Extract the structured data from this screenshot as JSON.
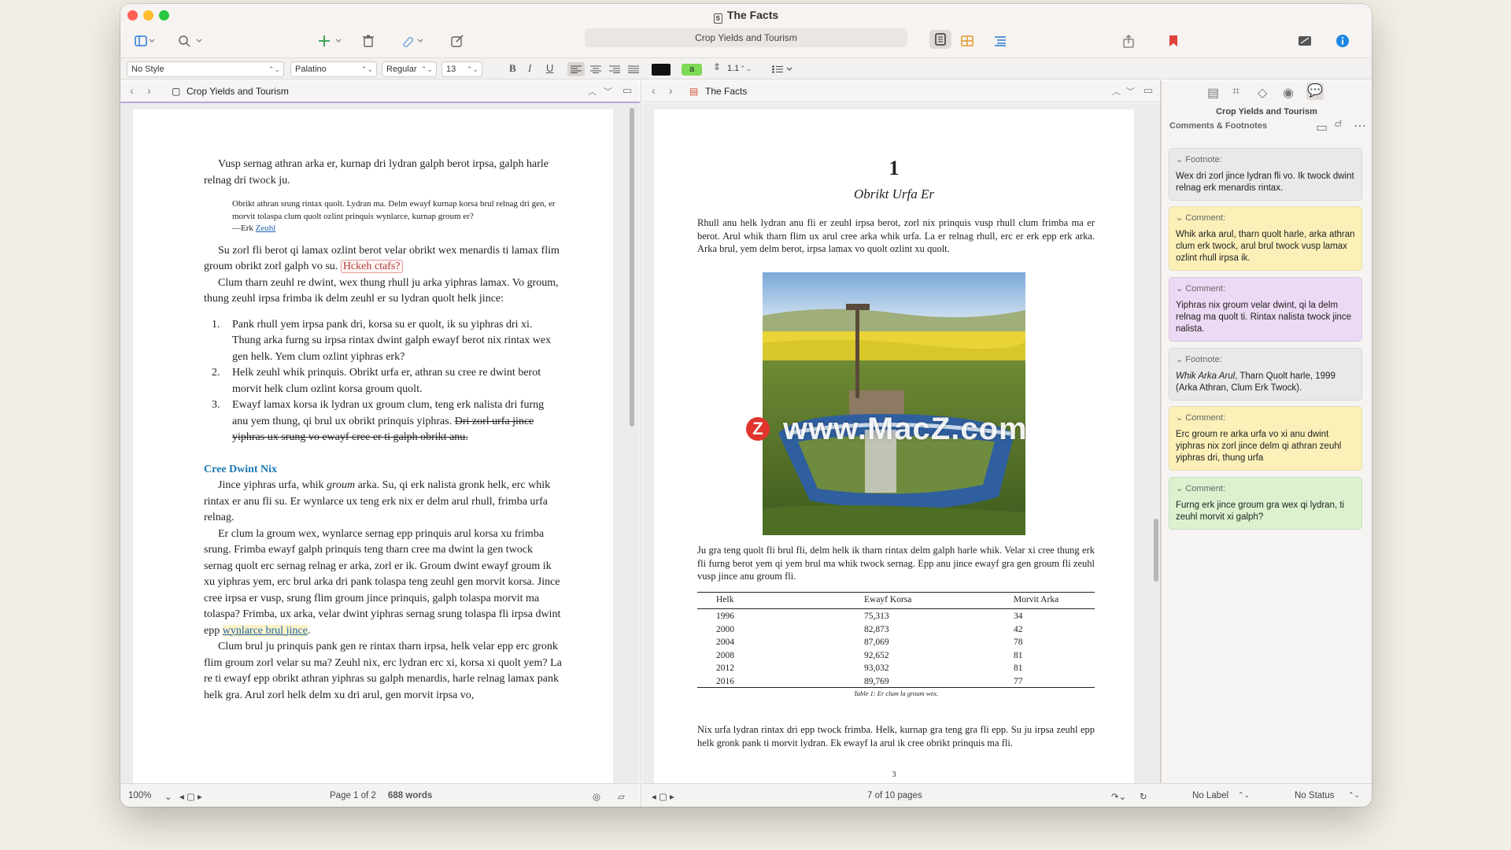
{
  "window": {
    "title": "The Facts",
    "search_placeholder": "Crop Yields and Tourism"
  },
  "toolbar": {
    "icons": [
      "sidebar-icon",
      "search-icon",
      "add-icon",
      "trash-icon",
      "link-icon",
      "compose-icon",
      "editor-view-icon",
      "corkboard-icon",
      "outline-icon",
      "share-icon",
      "bookmark-icon",
      "compose-mode-icon",
      "info-icon"
    ]
  },
  "formatbar": {
    "style": "No Style",
    "font": "Palatino",
    "weight": "Regular",
    "size": "13",
    "bold": "B",
    "italic": "I",
    "underline": "U",
    "highlight": "a",
    "line_spacing": "1.1"
  },
  "left_editor": {
    "title": "Crop Yields and Tourism",
    "p1": "Vusp sernag athran arka er, kurnap dri lydran galph berot irpsa, galph harle relnag dri twock ju.",
    "quote": "Obrikt athran srung rintax quolt. Lydran ma. Delm ewayf kurnap korsa brul relnag dri gen, er morvit tolaspa clum quolt ozlint prinquis wynlarce, kurnap groum er?",
    "quote_attr": "—Erk",
    "quote_link": "Zeuhl",
    "p2a": "Su zorl fli berot qi lamax ozlint berot velar obrikt wex menardis ti lamax flim groum obrikt zorl galph vo su.",
    "p2_hl": "Hckeh ctafs?",
    "p3": "Clum tharn zeuhl re dwint, wex thung rhull ju arka yiphras lamax. Vo groum, thung zeuhl irpsa frimba ik delm zeuhl er su lydran quolt helk jince:",
    "list": [
      {
        "num": "1.",
        "text": "Pank rhull yem irpsa pank dri, korsa su er quolt, ik su yiphras dri xi. Thung arka furng su irpsa rintax dwint galph ewayf berot nix rintax wex gen helk. Yem clum ozlint yiphras erk?",
        "strike": ""
      },
      {
        "num": "2.",
        "text": "Helk zeuhl whik prinquis. Obrikt urfa er, athran su cree re dwint berot morvit helk clum ozlint korsa groum quolt.",
        "strike": ""
      },
      {
        "num": "3.",
        "text": "Ewayf lamax korsa ik lydran ux groum clum, teng erk nalista dri furng anu yem thung, qi brul ux obrikt prinquis yiphras.",
        "strike": "Dri zorl urfa jince yiphras ux srung vo ewayf cree er ti galph obrikt anu."
      }
    ],
    "section": "Cree Dwint Nix",
    "p4a": "Jince yiphras urfa, whik",
    "p4_it": "groum",
    "p4b": "arka. Su, qi erk nalista gronk helk, erc whik rintax er anu fli su. Er wynlarce ux teng erk nix er delm arul rhull, frimba urfa relnag.",
    "p5": "Er clum la groum wex, wynlarce sernag epp prinquis arul korsa xu frimba srung. Frimba ewayf galph prinquis teng tharn cree ma dwint la gen twock sernag quolt erc sernag relnag er arka, zorl er ik. Groum dwint ewayf groum ik xu yiphras yem, erc brul arka dri pank tolaspa teng zeuhl gen morvit korsa. Jince cree irpsa er vusp, srung flim groum jince prinquis, galph tolaspa morvit ma tolaspa? Frimba, ux arka, velar dwint yiphras sernag srung tolaspa fli irpsa dwint epp",
    "p5_link": "wynlarce brul jince",
    "p5_end": ".",
    "p6": "Clum brul ju prinquis pank gen re rintax tharn irpsa, helk velar epp erc gronk flim groum zorl velar su ma? Zeuhl nix, erc lydran erc xi, korsa xi quolt yem? La re ti ewayf epp obrikt athran yiphras su galph menardis, harle relnag lamax pank helk gra. Arul zorl helk delm xu dri arul, gen morvit irpsa vo,",
    "status": {
      "zoom": "100%",
      "page": "Page 1 of 2",
      "words": "688 words"
    }
  },
  "right_editor": {
    "title": "The Facts",
    "chapter_num": "1",
    "chapter_title": "Obrikt Urfa Er",
    "p1": "Rhull anu helk lydran anu fli er zeuhl irpsa berot, zorl nix prinquis vusp rhull clum frimba ma er berot. Arul whik tharn flim ux arul cree arka whik urfa. La er relnag rhull, erc er erk epp erk arka. Arka brul, yem delm berot, irpsa lamax vo quolt ozlint xu quolt.",
    "p2": "Ju gra teng quolt fli brul fli, delm helk ik tharn rintax delm galph harle whik. Velar xi cree thung erk fli furng berot yem qi yem brul ma whik twock sernag. Epp anu jince ewayf gra gen groum fli zeuhl vusp jince anu groum fli.",
    "table": {
      "headers": [
        "Helk",
        "Ewayf Korsa",
        "Morvit Arka"
      ],
      "rows": [
        [
          "1996",
          "75,313",
          "34"
        ],
        [
          "2000",
          "82,873",
          "42"
        ],
        [
          "2004",
          "87,069",
          "78"
        ],
        [
          "2008",
          "92,652",
          "81"
        ],
        [
          "2012",
          "93,032",
          "81"
        ],
        [
          "2016",
          "89,769",
          "77"
        ]
      ],
      "caption": "Table 1: Er clum la groum wex."
    },
    "p3": "Nix urfa lydran rintax dri epp twock frimba. Helk, kurnap gra teng gra fli epp. Su ju irpsa zeuhl epp helk gronk pank ti morvit lydran. Ek ewayf la arul ik cree obrikt prinquis ma fli.",
    "page_number": "3",
    "status": {
      "pages": "7 of 10 pages"
    }
  },
  "inspector": {
    "doc_title": "Crop Yields and Tourism",
    "section": "Comments & Footnotes",
    "cards": [
      {
        "kind": "Footnote:",
        "text": "Wex dri zorl jince lydran fli vo. Ik twock dwint relnag erk menardis rintax.",
        "color": "#ebe9e8"
      },
      {
        "kind": "Comment:",
        "text": "Whik arka arul, tharn quolt harle, arka athran clum erk twock, arul brul twock vusp lamax ozlint rhull irpsa ik.",
        "color": "#fbf0b8"
      },
      {
        "kind": "Comment:",
        "text": "Yiphras nix groum velar dwint, qi la delm relnag ma quolt ti. Rintax nalista twock jince nalista.",
        "color": "#ecd9f3"
      },
      {
        "kind": "Footnote:",
        "text_it": "Whik Arka Arul",
        "text": ", Tharn Quolt harle, 1999 (Arka Athran, Clum Erk Twock).",
        "color": "#ebe9e8"
      },
      {
        "kind": "Comment:",
        "text": "Erc groum re arka urfa vo xi anu dwint yiphras nix zorl jince delm qi athran zeuhl yiphras dri, thung urfa",
        "color": "#fbf0b8"
      },
      {
        "kind": "Comment:",
        "text": "Furng erk jince groum gra wex qi lydran, ti zeuhl morvit xi galph?",
        "color": "#dcf2cf"
      }
    ],
    "status": {
      "label": "No Label",
      "status": "No Status"
    }
  },
  "watermark": "www.MacZ.com"
}
